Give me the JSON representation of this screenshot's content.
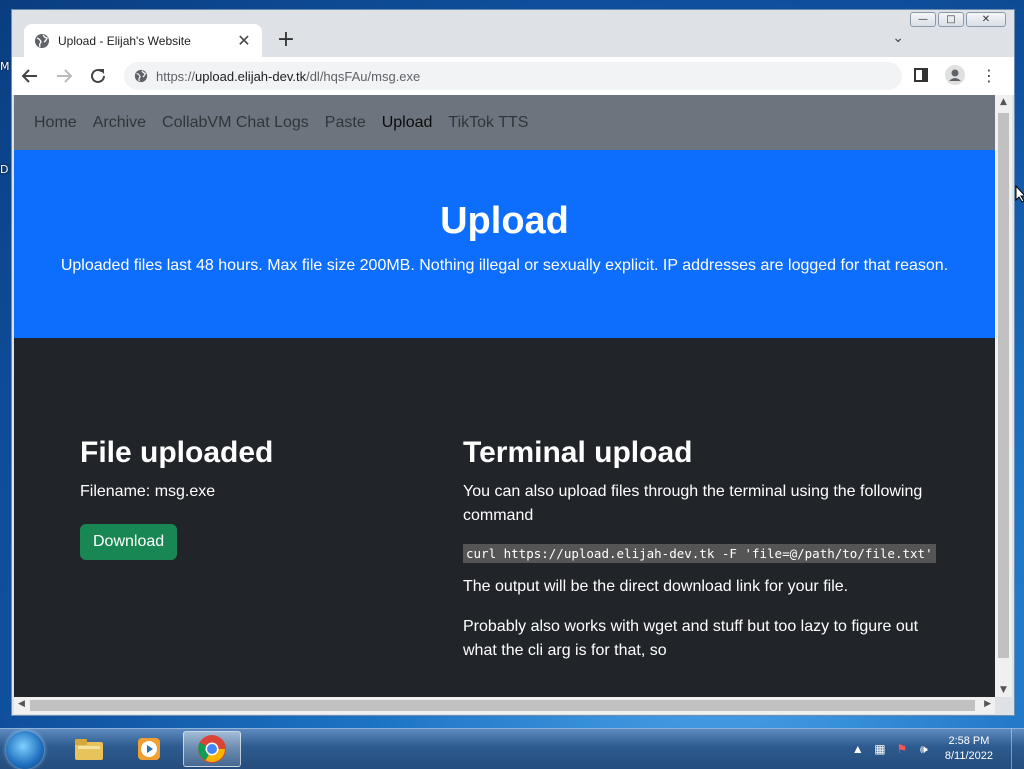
{
  "browser": {
    "tab_title": "Upload - Elijah's Website",
    "url_prefix": "https://",
    "url_host": "upload.elijah-dev.tk",
    "url_path": "/dl/hqsFAu/msg.exe"
  },
  "site": {
    "nav": [
      "Home",
      "Archive",
      "CollabVM Chat Logs",
      "Paste",
      "Upload",
      "TikTok TTS"
    ],
    "hero_title": "Upload",
    "hero_subtitle": "Uploaded files last 48 hours. Max file size 200MB. Nothing illegal or sexually explicit. IP addresses are logged for that reason.",
    "left_heading": "File uploaded",
    "filename_text": "Filename: msg.exe",
    "download_label": "Download",
    "right_heading": "Terminal upload",
    "terminal_intro": "You can also upload files through the terminal using the following command",
    "curl_command": "curl https://upload.elijah-dev.tk -F 'file=@/path/to/file.txt'",
    "output_note": "The output will be the direct download link for your file.",
    "wget_note": "Probably also works with wget and stuff but too lazy to figure out what the cli arg is for that, so"
  },
  "desktop": {
    "labels": [
      "M",
      "D"
    ]
  },
  "taskbar": {
    "time": "2:58 PM",
    "date": "8/11/2022"
  },
  "colors": {
    "hero_bg": "#0d6efd",
    "nav_bg": "#6c757d",
    "body_bg": "#212529",
    "download_bg": "#198754"
  }
}
